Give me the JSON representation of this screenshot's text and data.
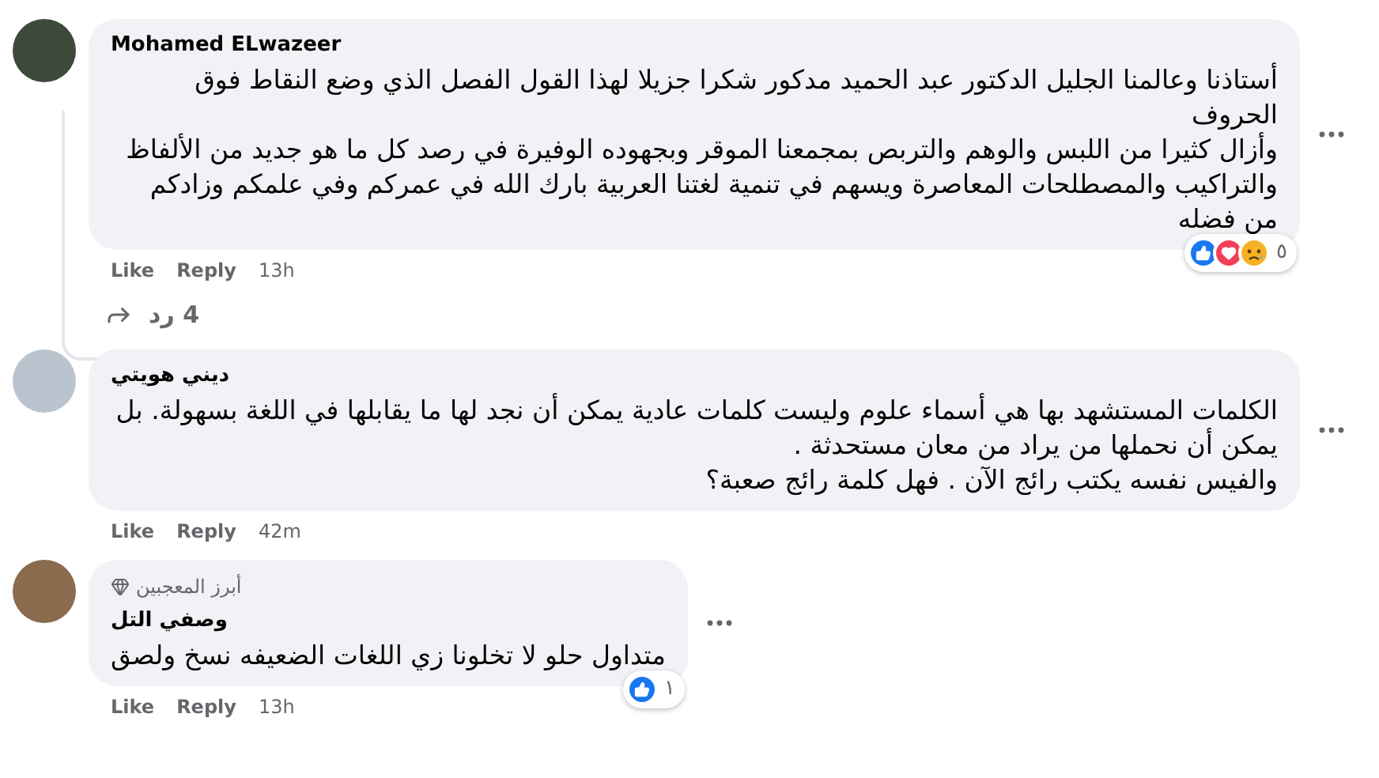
{
  "comments": [
    {
      "author": "Mohamed ELwazeer",
      "text": "أستاذنا وعالمنا الجليل الدكتور عبد الحميد مدكور شكرا جزيلا لهذا القول الفصل الذي وضع النقاط فوق الحروف\nوأزال كثيرا من اللبس والوهم والتربص بمجمعنا الموقر وبجهوده الوفيرة في رصد كل ما هو جديد من الألفاظ والتراكيب والمصطلحات المعاصرة ويسهم في تنمية لغتنا العربية بارك الله في عمركم وفي علمكم وزادكم من فضله",
      "like": "Like",
      "reply": "Reply",
      "time": "13h",
      "reactions": [
        {
          "kind": "like"
        },
        {
          "kind": "love"
        },
        {
          "kind": "sad"
        }
      ],
      "reaction_count": "٥",
      "replies": "4 رد"
    },
    {
      "author": "ديني هويتي",
      "text": "الكلمات المستشهد بها هي أسماء علوم وليست كلمات عادية يمكن أن نجد لها ما يقابلها في اللغة بسهولة. بل يمكن أن نحملها من يراد من معان مستحدثة .\nوالفيس نفسه يكتب رائج الآن . فهل كلمة رائج صعبة؟",
      "like": "Like",
      "reply": "Reply",
      "time": "42m"
    },
    {
      "author": "وصفي التل",
      "badge": "أبرز المعجبين",
      "text": "متداول حلو لا تخلونا زي اللغات الضعيفه نسخ ولصق",
      "like": "Like",
      "reply": "Reply",
      "time": "13h",
      "reactions": [
        {
          "kind": "like"
        }
      ],
      "reaction_count": "١"
    }
  ]
}
